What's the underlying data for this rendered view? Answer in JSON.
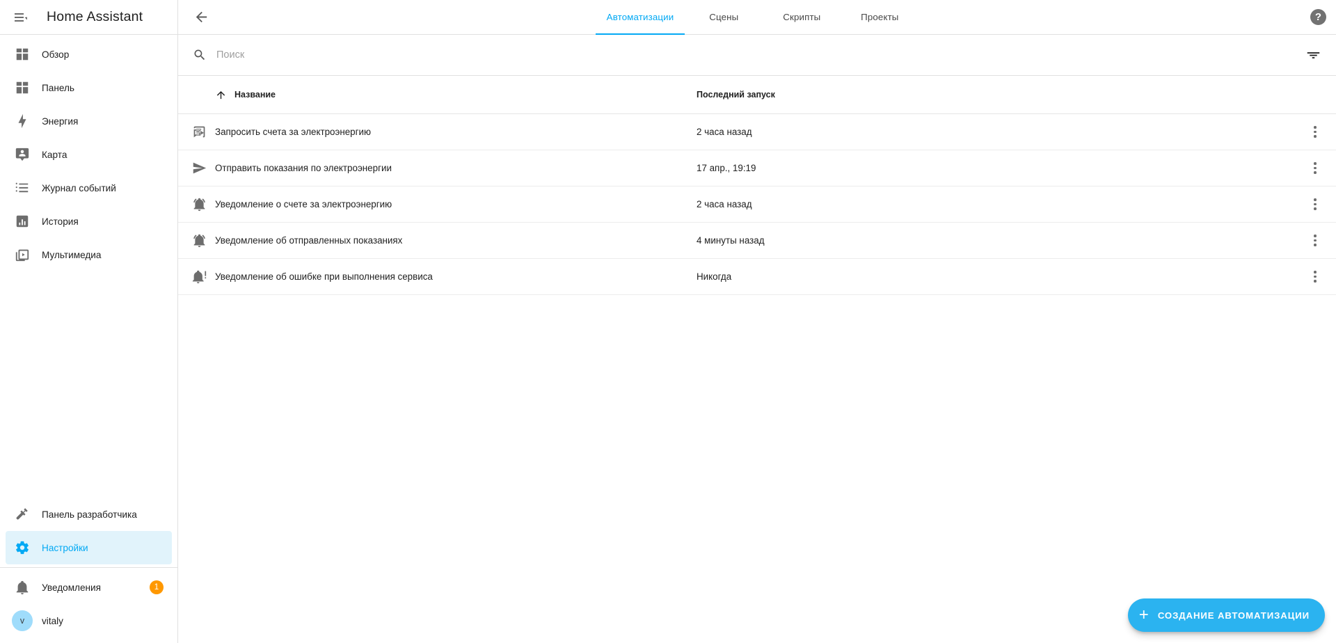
{
  "sidebar": {
    "title": "Home Assistant",
    "toggle_icon": "menu-collapse-icon",
    "items": [
      {
        "label": "Обзор",
        "icon": "view-dashboard-icon"
      },
      {
        "label": "Панель",
        "icon": "view-dashboard-icon"
      },
      {
        "label": "Энергия",
        "icon": "lightning-bolt-icon"
      },
      {
        "label": "Карта",
        "icon": "map-marker-account-icon"
      },
      {
        "label": "Журнал событий",
        "icon": "format-list-bulleted-icon"
      },
      {
        "label": "История",
        "icon": "chart-box-icon"
      },
      {
        "label": "Мультимедиа",
        "icon": "play-box-multiple-icon"
      }
    ],
    "bottom_items": [
      {
        "label": "Панель разработчика",
        "icon": "hammer-wrench-icon",
        "selected": false
      },
      {
        "label": "Настройки",
        "icon": "cog-icon",
        "selected": true
      }
    ],
    "notifications": {
      "label": "Уведомления",
      "icon": "bell-icon",
      "badge": "1"
    },
    "user": {
      "name": "vitaly",
      "initial": "v"
    }
  },
  "toolbar": {
    "back_icon": "arrow-left-icon",
    "help_icon": "help-circle-icon",
    "help_glyph": "?",
    "tabs": [
      {
        "label": "Автоматизации",
        "active": true
      },
      {
        "label": "Сцены",
        "active": false
      },
      {
        "label": "Скрипты",
        "active": false
      },
      {
        "label": "Проекты",
        "active": false
      }
    ]
  },
  "search": {
    "placeholder": "Поиск",
    "value": "",
    "search_icon": "search-icon",
    "filter_icon": "filter-variant-icon"
  },
  "table": {
    "columns": [
      {
        "key": "name",
        "label": "Название",
        "sorted": "asc",
        "sort_icon": "arrow-up-icon"
      },
      {
        "key": "last_triggered",
        "label": "Последний запуск"
      }
    ],
    "rows": [
      {
        "icon": "script-text-play-icon",
        "name": "Запросить счета за электроэнергию",
        "last_triggered": "2 часа назад",
        "menu_icon": "dots-vertical-icon"
      },
      {
        "icon": "send-icon",
        "name": "Отправить показания по электроэнергии",
        "last_triggered": "17 апр., 19:19",
        "menu_icon": "dots-vertical-icon"
      },
      {
        "icon": "bell-ring-icon",
        "name": "Уведомление о счете за электроэнергию",
        "last_triggered": "2 часа назад",
        "menu_icon": "dots-vertical-icon"
      },
      {
        "icon": "bell-ring-icon",
        "name": "Уведомление об отправленных показаниях",
        "last_triggered": "4 минуты назад",
        "menu_icon": "dots-vertical-icon"
      },
      {
        "icon": "bell-alert-icon",
        "name": "Уведомление об ошибке при выполнения сервиса",
        "last_triggered": "Никогда",
        "menu_icon": "dots-vertical-icon"
      }
    ]
  },
  "fab": {
    "label": "СОЗДАНИЕ АВТОМАТИЗАЦИИ",
    "plus": "+",
    "icon": "plus-icon"
  },
  "colors": {
    "accent": "#03a9f4",
    "fab": "#2bb3f0",
    "selected_bg": "#e1f3fb",
    "badge": "#ff9800",
    "avatar": "#9fdcfb",
    "text": "#212121",
    "muted": "#6d6d6d",
    "divider": "#e0e0e0"
  }
}
